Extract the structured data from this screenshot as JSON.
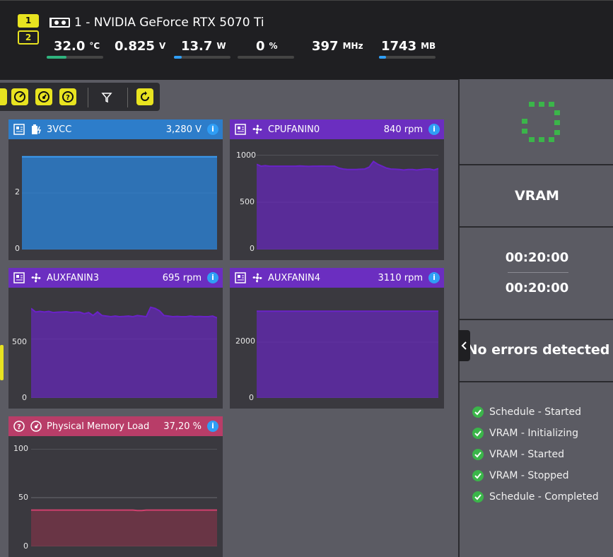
{
  "gpu": {
    "selectors": [
      "1",
      "2"
    ],
    "title": "1 - NVIDIA GeForce RTX 5070 Ti",
    "metrics": [
      {
        "value": "32.0",
        "unit": "°C",
        "fill_fraction": 0.35,
        "color": "#2fb37e"
      },
      {
        "value": "0.825",
        "unit": "V",
        "fill_fraction": 0,
        "color": "#2f9ef5"
      },
      {
        "value": "13.7",
        "unit": "W",
        "fill_fraction": 0.14,
        "color": "#2f9ef5"
      },
      {
        "value": "0",
        "unit": "%",
        "fill_fraction": 0,
        "color": "#2f9ef5"
      },
      {
        "value": "397",
        "unit": "MHz"
      },
      {
        "value": "1743",
        "unit": "MB",
        "fill_fraction": 0.12,
        "color": "#2f9ef5"
      }
    ]
  },
  "toolbar": {
    "icons": [
      "gauge-icon",
      "dashboard-icon",
      "help-icon",
      "filter-icon",
      "refresh-icon"
    ]
  },
  "panels": [
    {
      "label": "3VCC",
      "value": "3,280 V",
      "header_color": "#2d7dca",
      "icon": "battery-icon"
    },
    {
      "label": "CPUFANIN0",
      "value": "840 rpm",
      "header_color": "#6b2ec0",
      "icon": "fan-icon"
    },
    {
      "label": "AUXFANIN3",
      "value": "695 rpm",
      "header_color": "#6b2ec0",
      "icon": "fan-icon"
    },
    {
      "label": "AUXFANIN4",
      "value": "3110 rpm",
      "header_color": "#6b2ec0",
      "icon": "fan-icon"
    },
    {
      "label": "Physical Memory Load",
      "value": "37,20 %",
      "header_color": "#b83d68",
      "icon": "gauge-icon"
    }
  ],
  "chart_data": [
    {
      "type": "area",
      "title": "3VCC",
      "yticks": [
        0,
        2
      ],
      "ylim": [
        0,
        3.75
      ],
      "values": [
        3.28,
        3.28,
        3.28,
        3.28,
        3.28,
        3.28,
        3.28,
        3.28,
        3.28,
        3.28,
        3.28,
        3.28,
        3.28,
        3.28,
        3.28,
        3.28,
        3.28,
        3.28,
        3.28,
        3.28,
        3.28,
        3.28,
        3.28,
        3.28,
        3.28,
        3.28,
        3.28,
        3.28,
        3.28,
        3.28,
        3.28,
        3.28,
        3.28,
        3.28,
        3.28,
        3.28,
        3.28,
        3.28,
        3.28,
        3.28,
        3.28,
        3.28,
        3.28
      ],
      "color": "#2d7dca"
    },
    {
      "type": "area",
      "title": "CPUFANIN0",
      "yticks": [
        0,
        500,
        1000
      ],
      "ylim": [
        0,
        1000
      ],
      "values": [
        900,
        880,
        885,
        880,
        880,
        880,
        880,
        880,
        880,
        880,
        882,
        880,
        878,
        880,
        880,
        881,
        880,
        880,
        880,
        860,
        850,
        845,
        845,
        845,
        848,
        850,
        870,
        930,
        900,
        880,
        860,
        850,
        848,
        845,
        840,
        845,
        845,
        840,
        845,
        850,
        850,
        840,
        855
      ],
      "color": "#5f2aa8"
    },
    {
      "type": "area",
      "title": "AUXFANIN3",
      "yticks": [
        0,
        500
      ],
      "ylim": [
        0,
        900
      ],
      "values": [
        760,
        730,
        735,
        730,
        735,
        725,
        728,
        730,
        732,
        725,
        730,
        728,
        715,
        725,
        700,
        730,
        700,
        695,
        690,
        695,
        690,
        692,
        695,
        690,
        700,
        695,
        690,
        770,
        760,
        740,
        700,
        695,
        690,
        692,
        690,
        690,
        695,
        690,
        692,
        690,
        690,
        695,
        680
      ],
      "color": "#5f2aa8"
    },
    {
      "type": "area",
      "title": "AUXFANIN4",
      "yticks": [
        0,
        2000
      ],
      "ylim": [
        0,
        3800
      ],
      "values": [
        3110,
        3110,
        3110,
        3110,
        3110,
        3110,
        3110,
        3110,
        3110,
        3110,
        3110,
        3110,
        3110,
        3110,
        3110,
        3110,
        3110,
        3110,
        3110,
        3110,
        3110,
        3110,
        3110,
        3110,
        3110,
        3110,
        3110,
        3110,
        3110,
        3110,
        3110,
        3110,
        3110,
        3110,
        3110,
        3110,
        3110,
        3110,
        3110,
        3110,
        3110,
        3110,
        3110
      ],
      "color": "#5f2aa8"
    },
    {
      "type": "area",
      "title": "Physical Memory Load",
      "yticks": [
        0,
        50,
        100
      ],
      "ylim": [
        0,
        100
      ],
      "values": [
        37.2,
        37.2,
        37.2,
        37.2,
        37.2,
        37.2,
        37.2,
        37.2,
        37.2,
        37.2,
        37.2,
        37.2,
        37.2,
        37.2,
        37.2,
        37.2,
        37.2,
        37.2,
        37.2,
        37.2,
        37.2,
        37.2,
        37.2,
        37.2,
        36.8,
        36.8,
        37.2,
        37.2,
        37.2,
        37.2,
        37.2,
        37.2,
        37.2,
        37.2,
        37.2,
        37.2,
        37.2,
        37.2,
        37.2,
        37.2,
        37.2,
        37.2,
        37.2
      ],
      "color": "#7a3448"
    }
  ],
  "sidebar": {
    "test_name": "VRAM",
    "time_elapsed": "00:20:00",
    "time_total": "00:20:00",
    "status": "No errors detected",
    "log": [
      "Schedule - Started",
      "VRAM - Initializing",
      "VRAM - Started",
      "VRAM - Stopped",
      "Schedule - Completed"
    ],
    "collapse_icon": "chevron-left-icon"
  }
}
